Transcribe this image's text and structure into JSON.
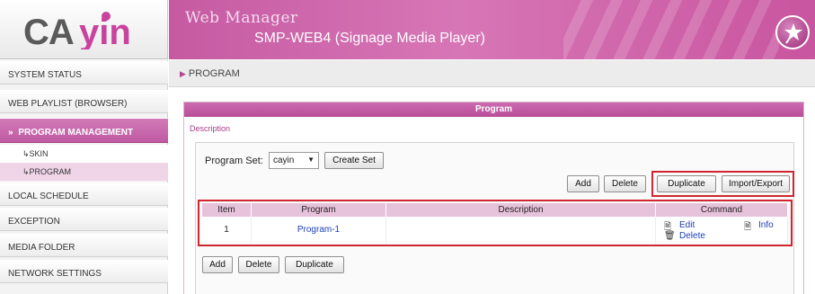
{
  "brand": {
    "logo_text": "CAYIN",
    "accent": "#c65aa2",
    "highlight": "#d0262f"
  },
  "header": {
    "product": "Web Manager",
    "device": "SMP-WEB4 (Signage Media Player)",
    "icon": "magic-wand-icon"
  },
  "sidebar": {
    "items": [
      {
        "label": "SYSTEM STATUS"
      },
      {
        "label": "WEB PLAYLIST (BROWSER)"
      },
      {
        "label": "PROGRAM MANAGEMENT",
        "active": true
      },
      {
        "label": "LOCAL SCHEDULE"
      },
      {
        "label": "EXCEPTION"
      },
      {
        "label": "MEDIA FOLDER"
      },
      {
        "label": "NETWORK SETTINGS"
      }
    ],
    "subitems": [
      {
        "label": "SKIN"
      },
      {
        "label": "PROGRAM",
        "active": true
      }
    ]
  },
  "breadcrumb": {
    "label": "PROGRAM"
  },
  "panel": {
    "title": "Program",
    "description_link": "Description",
    "program_set_label": "Program Set:",
    "program_set_value": "cayin",
    "create_set_label": "Create Set",
    "toolbar": {
      "add": "Add",
      "delete": "Delete",
      "duplicate": "Duplicate",
      "import_export": "Import/Export"
    },
    "table": {
      "headers": [
        "Item",
        "Program",
        "Description",
        "Command"
      ],
      "rows": [
        {
          "item": "1",
          "program": "Program-1",
          "description": "",
          "edit": "Edit",
          "delete": "Delete",
          "info": "Info"
        }
      ]
    },
    "bottom_toolbar": {
      "add": "Add",
      "delete": "Delete",
      "duplicate": "Duplicate"
    }
  }
}
